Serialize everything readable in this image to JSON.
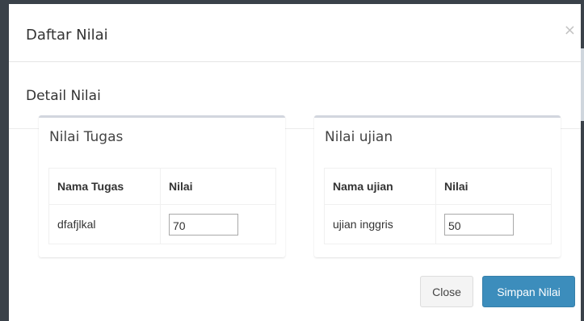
{
  "modal": {
    "title": "Daftar Nilai",
    "close_symbol": "×",
    "section_title": "Detail Nilai"
  },
  "tugas_panel": {
    "title": "Nilai Tugas",
    "columns": [
      "Nama Tugas",
      "Nilai"
    ],
    "rows": [
      {
        "name": "dfafjlkal",
        "value": "70"
      }
    ]
  },
  "ujian_panel": {
    "title": "Nilai ujian",
    "columns": [
      "Nama ujian",
      "Nilai"
    ],
    "rows": [
      {
        "name": "ujian inggris",
        "value": "50"
      }
    ]
  },
  "footer": {
    "close_label": "Close",
    "save_label": "Simpan Nilai"
  },
  "colors": {
    "primary": "#3c8dbc",
    "backdrop": "#3a4149",
    "panel_border": "#d2d6de"
  }
}
